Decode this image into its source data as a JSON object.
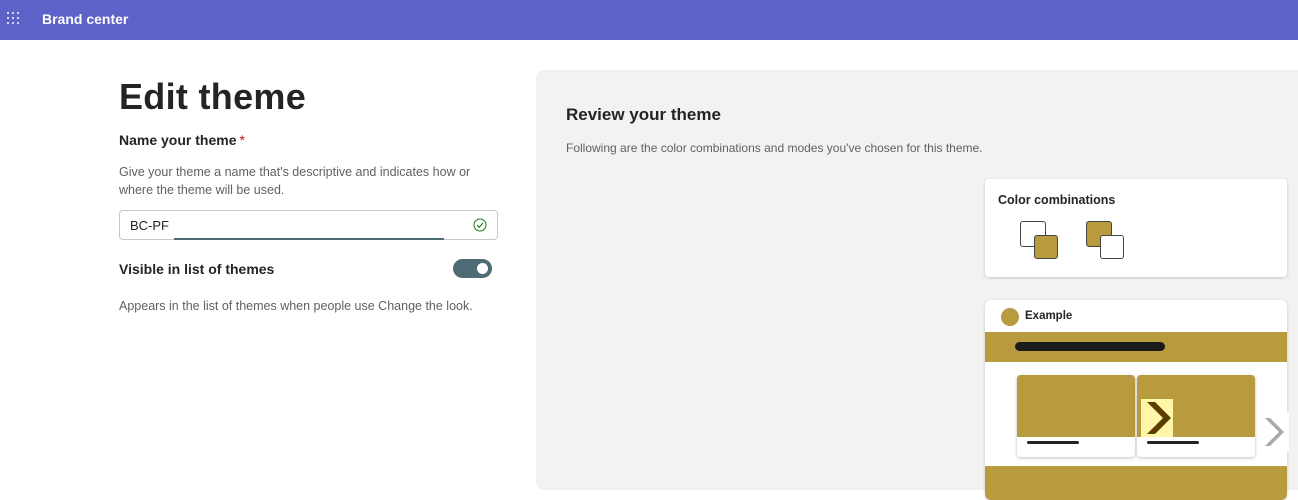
{
  "header": {
    "app_title": "Brand center",
    "menu_icon": "waffle-icon"
  },
  "editor": {
    "title": "Edit theme",
    "name_label": "Name your theme",
    "required_mark": "*",
    "name_help": "Give your theme a name that's descriptive and indicates how or where the theme will be used.",
    "name_value": "BC-PF",
    "visible_label": "Visible in list of themes",
    "visible_on": true,
    "visible_help": "Appears in the list of themes when people use Change the look."
  },
  "review": {
    "title": "Review your theme",
    "description": "Following are the color combinations and modes you've chosen for this theme.",
    "color_combinations": {
      "title": "Color combinations",
      "swatches": [
        {
          "back": "#ffffff",
          "front": "#b89a3f"
        },
        {
          "back": "#b89a3f",
          "front": "#ffffff"
        }
      ]
    },
    "example": {
      "label": "Example",
      "accent_color": "#b89a3f"
    }
  },
  "colors": {
    "header_bg": "#5d62c8",
    "accent": "#b89a3f",
    "toggle": "#4e6c74"
  }
}
